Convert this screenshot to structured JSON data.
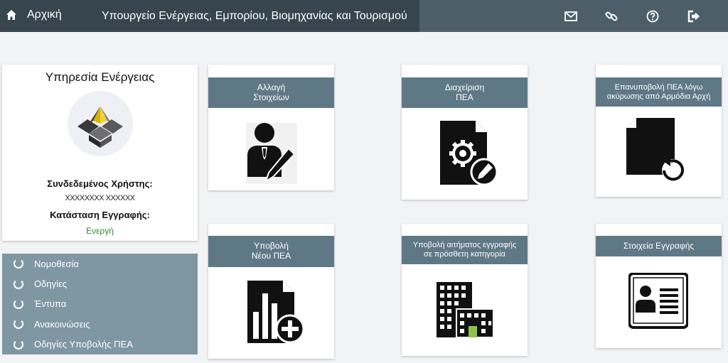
{
  "topbar": {
    "home_label": "Αρχική",
    "title": "Υπουργείο Ενέργειας, Εμπορίου, Βιομηχανίας και Τουρισμού",
    "icons": [
      "home-icon",
      "envelope-icon",
      "link-icon",
      "help-icon",
      "logout-icon"
    ]
  },
  "profile": {
    "service": "Υπηρεσία Ενέργειας",
    "user_label": "Συνδεδεμένος Χρήστης:",
    "user_value": "XXXXXXXX XXXXXX",
    "status_label": "Κατάσταση Εγγραφής:",
    "status_value": "Ενεργή"
  },
  "sidemenu": {
    "items": [
      {
        "label": "Νομοθεσία"
      },
      {
        "label": "Οδηγίες"
      },
      {
        "label": "Έντυπα"
      },
      {
        "label": "Ανακοινώσεις"
      },
      {
        "label": "Οδηγίες Υποβολής ΠΕΑ"
      }
    ]
  },
  "tiles": [
    {
      "title": "Αλλαγή\nΣτοιχείων",
      "icon": "user-edit-icon"
    },
    {
      "title": "Διαχείριση\nΠΕΑ",
      "icon": "document-settings-icon"
    },
    {
      "title": "Επανυποβολή ΠΕΑ λόγω\nακύρωσης από Αρμόδια Αρχή",
      "icon": "document-resubmit-icon"
    },
    {
      "title": "Υποβολή\nΝέου ΠΕΑ",
      "icon": "document-chart-add-icon"
    },
    {
      "title": "Υποβολή αιτήματος εγγραφής\nσε πρόσθετη κατηγορία",
      "icon": "building-icon"
    },
    {
      "title": "Στοιχεία Εγγραφής",
      "icon": "id-card-icon"
    }
  ],
  "colors": {
    "topbar": "#4e5e68",
    "topbar_dark": "#37454f",
    "tile_header": "#5f7885",
    "sidemenu": "#7f97a3",
    "status_active": "#2e8b2e"
  }
}
